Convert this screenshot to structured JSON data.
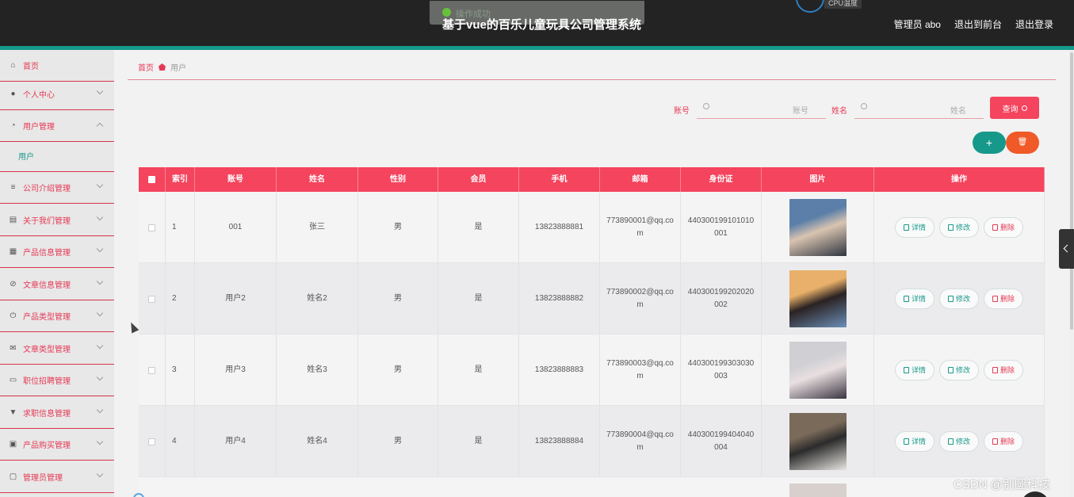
{
  "header": {
    "title": "基于vue的百乐儿童玩具公司管理系统",
    "toast": "操作成功",
    "cpu_label": "CPU温度",
    "admin": "管理员 abo",
    "to_front": "退出到前台",
    "logout": "退出登录"
  },
  "sidebar": {
    "items": [
      {
        "label": "首页",
        "icon": "home-icon",
        "glyph": "⌂"
      },
      {
        "label": "个人中心",
        "icon": "user-icon",
        "glyph": "●"
      },
      {
        "label": "用户管理",
        "icon": "gauge-icon",
        "glyph": "◔"
      },
      {
        "label": "公司介绍管理",
        "icon": "list-icon",
        "glyph": "≡"
      },
      {
        "label": "关于我们管理",
        "icon": "chart-icon",
        "glyph": "▤"
      },
      {
        "label": "产品信息管理",
        "icon": "grid-icon",
        "glyph": "▦"
      },
      {
        "label": "文章信息管理",
        "icon": "no-entry-icon",
        "glyph": "⊘"
      },
      {
        "label": "产品类型管理",
        "icon": "power-icon",
        "glyph": "⏻"
      },
      {
        "label": "文章类型管理",
        "icon": "mail-icon",
        "glyph": "✉"
      },
      {
        "label": "职位招聘管理",
        "icon": "monitor-icon",
        "glyph": "▭"
      },
      {
        "label": "求职信息管理",
        "icon": "tag-icon",
        "glyph": "▼"
      },
      {
        "label": "产品购买管理",
        "icon": "clipboard-icon",
        "glyph": "▣"
      },
      {
        "label": "管理员管理",
        "icon": "message-icon",
        "glyph": "▢"
      }
    ],
    "sub_item": "用户"
  },
  "breadcrumb": {
    "home": "首页",
    "current": "用户"
  },
  "search": {
    "account_label": "账号",
    "account_placeholder": "账号",
    "name_label": "姓名",
    "name_placeholder": "姓名",
    "query": "查询"
  },
  "actions": {
    "add": "+",
    "delete": "🗑"
  },
  "table": {
    "columns": [
      "索引",
      "账号",
      "姓名",
      "性别",
      "会员",
      "手机",
      "邮箱",
      "身份证",
      "图片",
      "操作"
    ],
    "rows": [
      {
        "index": "1",
        "account": "001",
        "name": "张三",
        "gender": "男",
        "member": "是",
        "phone": "13823888881",
        "email": "773890001@qq.com",
        "id_card": "440300199101010001",
        "pic_colors": [
          "#5b7fa8",
          "#2e3440",
          "#d9c4b0"
        ]
      },
      {
        "index": "2",
        "account": "用户2",
        "name": "姓名2",
        "gender": "男",
        "member": "是",
        "phone": "13823888882",
        "email": "773890002@qq.com",
        "id_card": "440300199202020002",
        "pic_colors": [
          "#e8b06a",
          "#6b8fb8",
          "#2a2222"
        ]
      },
      {
        "index": "3",
        "account": "用户3",
        "name": "姓名3",
        "gender": "男",
        "member": "是",
        "phone": "13823888883",
        "email": "773890003@qq.com",
        "id_card": "440300199303030003",
        "pic_colors": [
          "#cfcfd4",
          "#3a3440",
          "#e9dfe0"
        ]
      },
      {
        "index": "4",
        "account": "用户4",
        "name": "姓名4",
        "gender": "男",
        "member": "是",
        "phone": "13823888884",
        "email": "773890004@qq.com",
        "id_card": "440300199404040004",
        "pic_colors": [
          "#7a6a5a",
          "#e8e6e2",
          "#2b2b2b"
        ]
      }
    ],
    "op_detail": "详情",
    "op_edit": "修改",
    "op_delete": "删除"
  },
  "watermark": "CSDN @别圆科技"
}
